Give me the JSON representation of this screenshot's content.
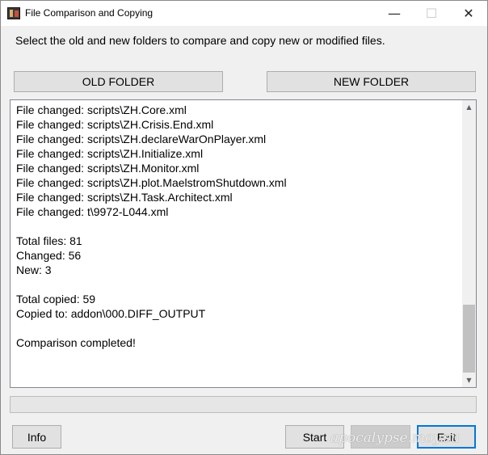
{
  "window": {
    "title": "File Comparison and Copying",
    "minimize_glyph": "—",
    "maximize_glyph": "☐",
    "close_glyph": "✕"
  },
  "instruction": "Select the old and new folders to compare and copy new or modified files.",
  "buttons": {
    "old_folder": "OLD FOLDER",
    "new_folder": "NEW FOLDER",
    "info": "Info",
    "start": "Start",
    "copy": "",
    "exit": "Exit"
  },
  "log": {
    "lines": [
      "File changed: scripts\\ZH.Core.xml",
      "File changed: scripts\\ZH.Crisis.End.xml",
      "File changed: scripts\\ZH.declareWarOnPlayer.xml",
      "File changed: scripts\\ZH.Initialize.xml",
      "File changed: scripts\\ZH.Monitor.xml",
      "File changed: scripts\\ZH.plot.MaelstromShutdown.xml",
      "File changed: scripts\\ZH.Task.Architect.xml",
      "File changed: t\\9972-L044.xml",
      "",
      "Total files: 81",
      "Changed: 56",
      "New: 3",
      "",
      "Total copied: 59",
      "Copied to: addon\\000.DIFF_OUTPUT",
      "",
      "Comparison completed!"
    ],
    "scroll_position": 1.0
  },
  "progress": {
    "value": 0
  },
  "watermark": "apocalypse.moy.su",
  "icons": {
    "app": "app-icon",
    "scroll_up": "chevron-up-icon",
    "scroll_down": "chevron-down-icon"
  }
}
